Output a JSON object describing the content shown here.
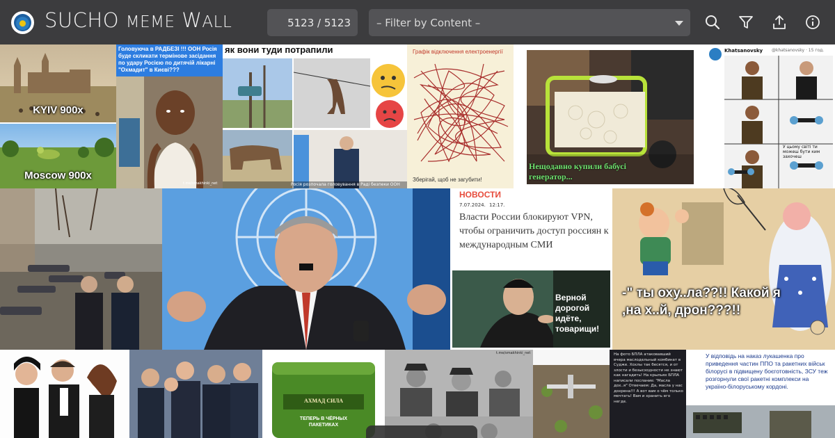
{
  "app": {
    "title_big1": "SUCHO ",
    "title_small1": "MEME",
    "title_big2": " W",
    "title_small2": "ALL",
    "counter": "5123 / 5123",
    "filter_placeholder": "– Filter by Content –"
  },
  "toolbar": {
    "search_icon": "search-icon",
    "filter_icon": "funnel-icon",
    "share_icon": "upload-icon",
    "info_icon": "info-icon"
  },
  "memes": {
    "m1_top": "KYIV 900x",
    "m1_bottom": "Moscow 900x",
    "m2_banner": "Головуюча в РАДБЕЗІ !!! ООН Росія буде скликати термінове засідання по удару Росією по дитячій лікарні \"Охмадит\" в Києві???",
    "m2_credit": "t.me/smakhinki_net",
    "m3_title": "як вони туди потрапили",
    "m3_caption": "Росія розпочала головування в Раді безпеки ООН",
    "m4_top": "Графік відключення електроенергії",
    "m4_bottom": "Зберігай, щоб не загубити!",
    "m5_caption": "Нещодавно купили бабусі генератор...",
    "m6_name": "Khatsanovsky",
    "m6_handle": "@khatsanovsky · 15 год.",
    "m6_bubble": "У цьому світі ти можеш бути ким захочеш",
    "m9_header": "НОВОСТИ",
    "m9_date": "7.07.2024.",
    "m9_time": "12:17.",
    "m9_text": "Власти России блокируют VPN, чтобы ограничить доступ россиян к международным СМИ",
    "m9_bubble": "Верной дорогой идёте, товарищи!",
    "m10_caption": "-\" ты оху..ла??!! Какой я ,на х..й, дрон???!!",
    "m13_brand": "АХМАД СИЛА",
    "m13_sub": "ТЕПЕРЬ В ЧЁРНЫХ ПАКЕТИКАХ",
    "m14_credit": "t.me/smakhinki_net",
    "m16_text": "На фото БПЛА атаковавший вчера маслодельный комбинат в Судже. Хохлы так бесятся, и от злости и безысходности не знают как нагадить! На крыльях БПЛА написали послание: \"Масла дох..я\" Отвечаем: Да, масла у нас дохрена!!! А вот вам о чём только мечтать! Вам и хранить его негде.",
    "m17_text": "У відповідь на наказ лукашенка про приведення частин ППО та ракетних військ білорусі в підвищену боєготовність, ЗСУ теж розгорнули свої ракетні комплекси на україно-білоруському кордоні."
  },
  "colors": {
    "topbar": "#3c3c3e",
    "field": "#535356",
    "un_blue": "#4b92db",
    "accent_blue": "#2b7ec3"
  }
}
